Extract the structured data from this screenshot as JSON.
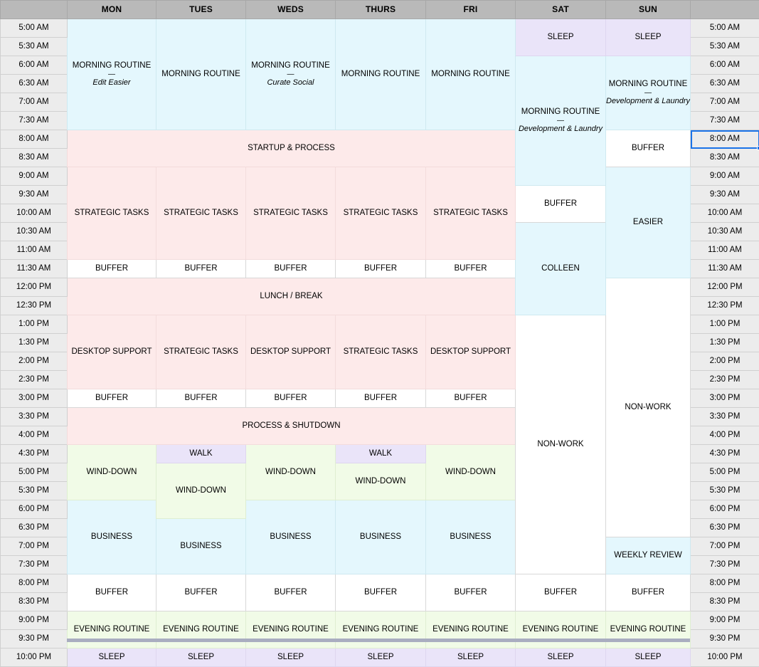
{
  "sheet": {
    "title": "Weekly Schedule",
    "accent_color": "#1a73e8",
    "header_bg": "#b9b9b9",
    "time_gutter_bg": "#ececec",
    "selected_cell": "8:00 AM"
  },
  "colors": {
    "blue": "#e4f7fd",
    "pink": "#fdeaea",
    "green": "#f1fbe7",
    "purple": "#eae4f9",
    "white": "#ffffff"
  },
  "columns": {
    "corner_left": "",
    "corner_right": "",
    "days": [
      "MON",
      "TUES",
      "WEDS",
      "THURS",
      "FRI",
      "SAT",
      "SUN"
    ]
  },
  "times": [
    "5:00 AM",
    "5:30 AM",
    "6:00 AM",
    "6:30 AM",
    "7:00 AM",
    "7:30 AM",
    "8:00 AM",
    "8:30 AM",
    "9:00 AM",
    "9:30 AM",
    "10:00 AM",
    "10:30 AM",
    "11:00 AM",
    "11:30 AM",
    "12:00 PM",
    "12:30 PM",
    "1:00 PM",
    "1:30 PM",
    "2:00 PM",
    "2:30 PM",
    "3:00 PM",
    "3:30 PM",
    "4:00 PM",
    "4:30 PM",
    "5:00 PM",
    "5:30 PM",
    "6:00 PM",
    "6:30 PM",
    "7:00 PM",
    "7:30 PM",
    "8:00 PM",
    "8:30 PM",
    "9:00 PM",
    "9:30 PM",
    "10:00 PM"
  ],
  "labels": {
    "morning_routine": "MORNING ROUTINE",
    "edit_easier": "Edit Easier",
    "curate_social": "Curate Social",
    "development_laundry": "Development & Laundry",
    "startup_process": "STARTUP & PROCESS",
    "strategic_tasks": "STRATEGIC TASKS",
    "buffer": "BUFFER",
    "lunch_break": "LUNCH / BREAK",
    "desktop_support": "DESKTOP SUPPORT",
    "process_shutdown": "PROCESS & SHUTDOWN",
    "walk": "WALK",
    "wind_down": "WIND-DOWN",
    "business": "BUSINESS",
    "evening_routine": "EVENING ROUTINE",
    "sleep": "SLEEP",
    "non_work": "NON-WORK",
    "colleen": "COLLEEN",
    "easier": "EASIER",
    "weekly_review": "WEEKLY REVIEW",
    "rule": "—"
  },
  "schedule": {
    "MON": [
      {
        "row": 0,
        "span": 6,
        "text": "MORNING ROUTINE",
        "sub": "Edit Easier",
        "color": "blue"
      },
      {
        "row": 6,
        "span": 2,
        "text": "STARTUP & PROCESS",
        "merged_label": true,
        "color": "pink"
      },
      {
        "row": 8,
        "span": 5,
        "text": "STRATEGIC TASKS",
        "color": "pink"
      },
      {
        "row": 13,
        "span": 1,
        "text": "BUFFER",
        "color": "white"
      },
      {
        "row": 14,
        "span": 2,
        "text": "LUNCH / BREAK",
        "merged_label": true,
        "color": "pink"
      },
      {
        "row": 16,
        "span": 4,
        "text": "DESKTOP SUPPORT",
        "color": "pink"
      },
      {
        "row": 20,
        "span": 1,
        "text": "BUFFER",
        "color": "white"
      },
      {
        "row": 21,
        "span": 2,
        "text": "PROCESS & SHUTDOWN",
        "merged_label": true,
        "color": "pink"
      },
      {
        "row": 23,
        "span": 3,
        "text": "WIND-DOWN",
        "color": "green"
      },
      {
        "row": 26,
        "span": 4,
        "text": "BUSINESS",
        "color": "blue"
      },
      {
        "row": 30,
        "span": 2,
        "text": "BUFFER",
        "color": "white"
      },
      {
        "row": 32,
        "span": 2,
        "text": "EVENING ROUTINE",
        "color": "green"
      },
      {
        "row": 34,
        "span": 1,
        "text": "SLEEP",
        "color": "purple"
      }
    ],
    "TUES": [
      {
        "row": 0,
        "span": 6,
        "text": "MORNING ROUTINE",
        "color": "blue"
      },
      {
        "row": 6,
        "span": 2,
        "text": "",
        "color": "pink"
      },
      {
        "row": 8,
        "span": 5,
        "text": "STRATEGIC TASKS",
        "color": "pink"
      },
      {
        "row": 13,
        "span": 1,
        "text": "BUFFER",
        "color": "white"
      },
      {
        "row": 14,
        "span": 2,
        "text": "",
        "color": "pink"
      },
      {
        "row": 16,
        "span": 4,
        "text": "STRATEGIC TASKS",
        "color": "pink"
      },
      {
        "row": 20,
        "span": 1,
        "text": "BUFFER",
        "color": "white"
      },
      {
        "row": 21,
        "span": 2,
        "text": "",
        "color": "pink"
      },
      {
        "row": 23,
        "span": 1,
        "text": "WALK",
        "color": "purple"
      },
      {
        "row": 24,
        "span": 3,
        "text": "WIND-DOWN",
        "color": "green"
      },
      {
        "row": 27,
        "span": 3,
        "text": "BUSINESS",
        "color": "blue"
      },
      {
        "row": 30,
        "span": 2,
        "text": "BUFFER",
        "color": "white"
      },
      {
        "row": 32,
        "span": 2,
        "text": "EVENING ROUTINE",
        "color": "green"
      },
      {
        "row": 34,
        "span": 1,
        "text": "SLEEP",
        "color": "purple"
      }
    ],
    "WEDS": [
      {
        "row": 0,
        "span": 6,
        "text": "MORNING ROUTINE",
        "sub": "Curate Social",
        "color": "blue"
      },
      {
        "row": 6,
        "span": 2,
        "text": "",
        "color": "pink"
      },
      {
        "row": 8,
        "span": 5,
        "text": "STRATEGIC TASKS",
        "color": "pink"
      },
      {
        "row": 13,
        "span": 1,
        "text": "BUFFER",
        "color": "white"
      },
      {
        "row": 14,
        "span": 2,
        "text": "",
        "color": "pink"
      },
      {
        "row": 16,
        "span": 4,
        "text": "DESKTOP SUPPORT",
        "color": "pink"
      },
      {
        "row": 20,
        "span": 1,
        "text": "BUFFER",
        "color": "white"
      },
      {
        "row": 21,
        "span": 2,
        "text": "",
        "color": "pink"
      },
      {
        "row": 23,
        "span": 3,
        "text": "WIND-DOWN",
        "color": "green"
      },
      {
        "row": 26,
        "span": 4,
        "text": "BUSINESS",
        "color": "blue"
      },
      {
        "row": 30,
        "span": 2,
        "text": "BUFFER",
        "color": "white"
      },
      {
        "row": 32,
        "span": 2,
        "text": "EVENING ROUTINE",
        "color": "green"
      },
      {
        "row": 34,
        "span": 1,
        "text": "SLEEP",
        "color": "purple"
      }
    ],
    "THURS": [
      {
        "row": 0,
        "span": 6,
        "text": "MORNING ROUTINE",
        "color": "blue"
      },
      {
        "row": 6,
        "span": 2,
        "text": "",
        "color": "pink"
      },
      {
        "row": 8,
        "span": 5,
        "text": "STRATEGIC TASKS",
        "color": "pink"
      },
      {
        "row": 13,
        "span": 1,
        "text": "BUFFER",
        "color": "white"
      },
      {
        "row": 14,
        "span": 2,
        "text": "",
        "color": "pink"
      },
      {
        "row": 16,
        "span": 4,
        "text": "STRATEGIC TASKS",
        "color": "pink"
      },
      {
        "row": 20,
        "span": 1,
        "text": "BUFFER",
        "color": "white"
      },
      {
        "row": 21,
        "span": 2,
        "text": "",
        "color": "pink"
      },
      {
        "row": 23,
        "span": 1,
        "text": "WALK",
        "color": "purple"
      },
      {
        "row": 24,
        "span": 2,
        "text": "WIND-DOWN",
        "color": "green"
      },
      {
        "row": 26,
        "span": 4,
        "text": "BUSINESS",
        "color": "blue"
      },
      {
        "row": 30,
        "span": 2,
        "text": "BUFFER",
        "color": "white"
      },
      {
        "row": 32,
        "span": 2,
        "text": "EVENING ROUTINE",
        "color": "green"
      },
      {
        "row": 34,
        "span": 1,
        "text": "SLEEP",
        "color": "purple"
      }
    ],
    "FRI": [
      {
        "row": 0,
        "span": 6,
        "text": "MORNING ROUTINE",
        "color": "blue"
      },
      {
        "row": 6,
        "span": 2,
        "text": "",
        "color": "pink"
      },
      {
        "row": 8,
        "span": 5,
        "text": "STRATEGIC TASKS",
        "color": "pink"
      },
      {
        "row": 13,
        "span": 1,
        "text": "BUFFER",
        "color": "white"
      },
      {
        "row": 14,
        "span": 2,
        "text": "",
        "color": "pink"
      },
      {
        "row": 16,
        "span": 4,
        "text": "DESKTOP SUPPORT",
        "color": "pink"
      },
      {
        "row": 20,
        "span": 1,
        "text": "BUFFER",
        "color": "white"
      },
      {
        "row": 21,
        "span": 2,
        "text": "",
        "color": "pink"
      },
      {
        "row": 23,
        "span": 3,
        "text": "WIND-DOWN",
        "color": "green"
      },
      {
        "row": 26,
        "span": 4,
        "text": "BUSINESS",
        "color": "blue"
      },
      {
        "row": 30,
        "span": 2,
        "text": "BUFFER",
        "color": "white"
      },
      {
        "row": 32,
        "span": 2,
        "text": "EVENING ROUTINE",
        "color": "green"
      },
      {
        "row": 34,
        "span": 1,
        "text": "SLEEP",
        "color": "purple"
      }
    ],
    "SAT": [
      {
        "row": 0,
        "span": 2,
        "text": "SLEEP",
        "color": "purple"
      },
      {
        "row": 2,
        "span": 7,
        "text": "MORNING ROUTINE",
        "sub": "Development & Laundry",
        "color": "blue"
      },
      {
        "row": 9,
        "span": 2,
        "text": "BUFFER",
        "color": "white"
      },
      {
        "row": 11,
        "span": 5,
        "text": "COLLEEN",
        "color": "blue"
      },
      {
        "row": 16,
        "span": 14,
        "text": "NON-WORK",
        "color": "white"
      },
      {
        "row": 30,
        "span": 2,
        "text": "BUFFER",
        "color": "white"
      },
      {
        "row": 32,
        "span": 2,
        "text": "EVENING ROUTINE",
        "color": "green"
      },
      {
        "row": 34,
        "span": 1,
        "text": "SLEEP",
        "color": "purple"
      }
    ],
    "SUN": [
      {
        "row": 0,
        "span": 2,
        "text": "SLEEP",
        "color": "purple"
      },
      {
        "row": 2,
        "span": 4,
        "text": "MORNING ROUTINE",
        "sub": "Development & Laundry",
        "color": "blue"
      },
      {
        "row": 6,
        "span": 2,
        "text": "BUFFER",
        "color": "white"
      },
      {
        "row": 8,
        "span": 6,
        "text": "EASIER",
        "color": "blue"
      },
      {
        "row": 14,
        "span": 14,
        "text": "NON-WORK",
        "color": "white"
      },
      {
        "row": 28,
        "span": 2,
        "text": "WEEKLY REVIEW",
        "color": "blue"
      },
      {
        "row": 30,
        "span": 2,
        "text": "BUFFER",
        "color": "white"
      },
      {
        "row": 32,
        "span": 2,
        "text": "EVENING ROUTINE",
        "color": "green"
      },
      {
        "row": 34,
        "span": 1,
        "text": "SLEEP",
        "color": "purple"
      }
    ]
  },
  "banners": [
    {
      "row": 6,
      "span": 2,
      "text": "STARTUP & PROCESS",
      "color": "pink"
    },
    {
      "row": 14,
      "span": 2,
      "text": "LUNCH / BREAK",
      "color": "pink"
    },
    {
      "row": 21,
      "span": 2,
      "text": "PROCESS & SHUTDOWN",
      "color": "pink"
    }
  ]
}
